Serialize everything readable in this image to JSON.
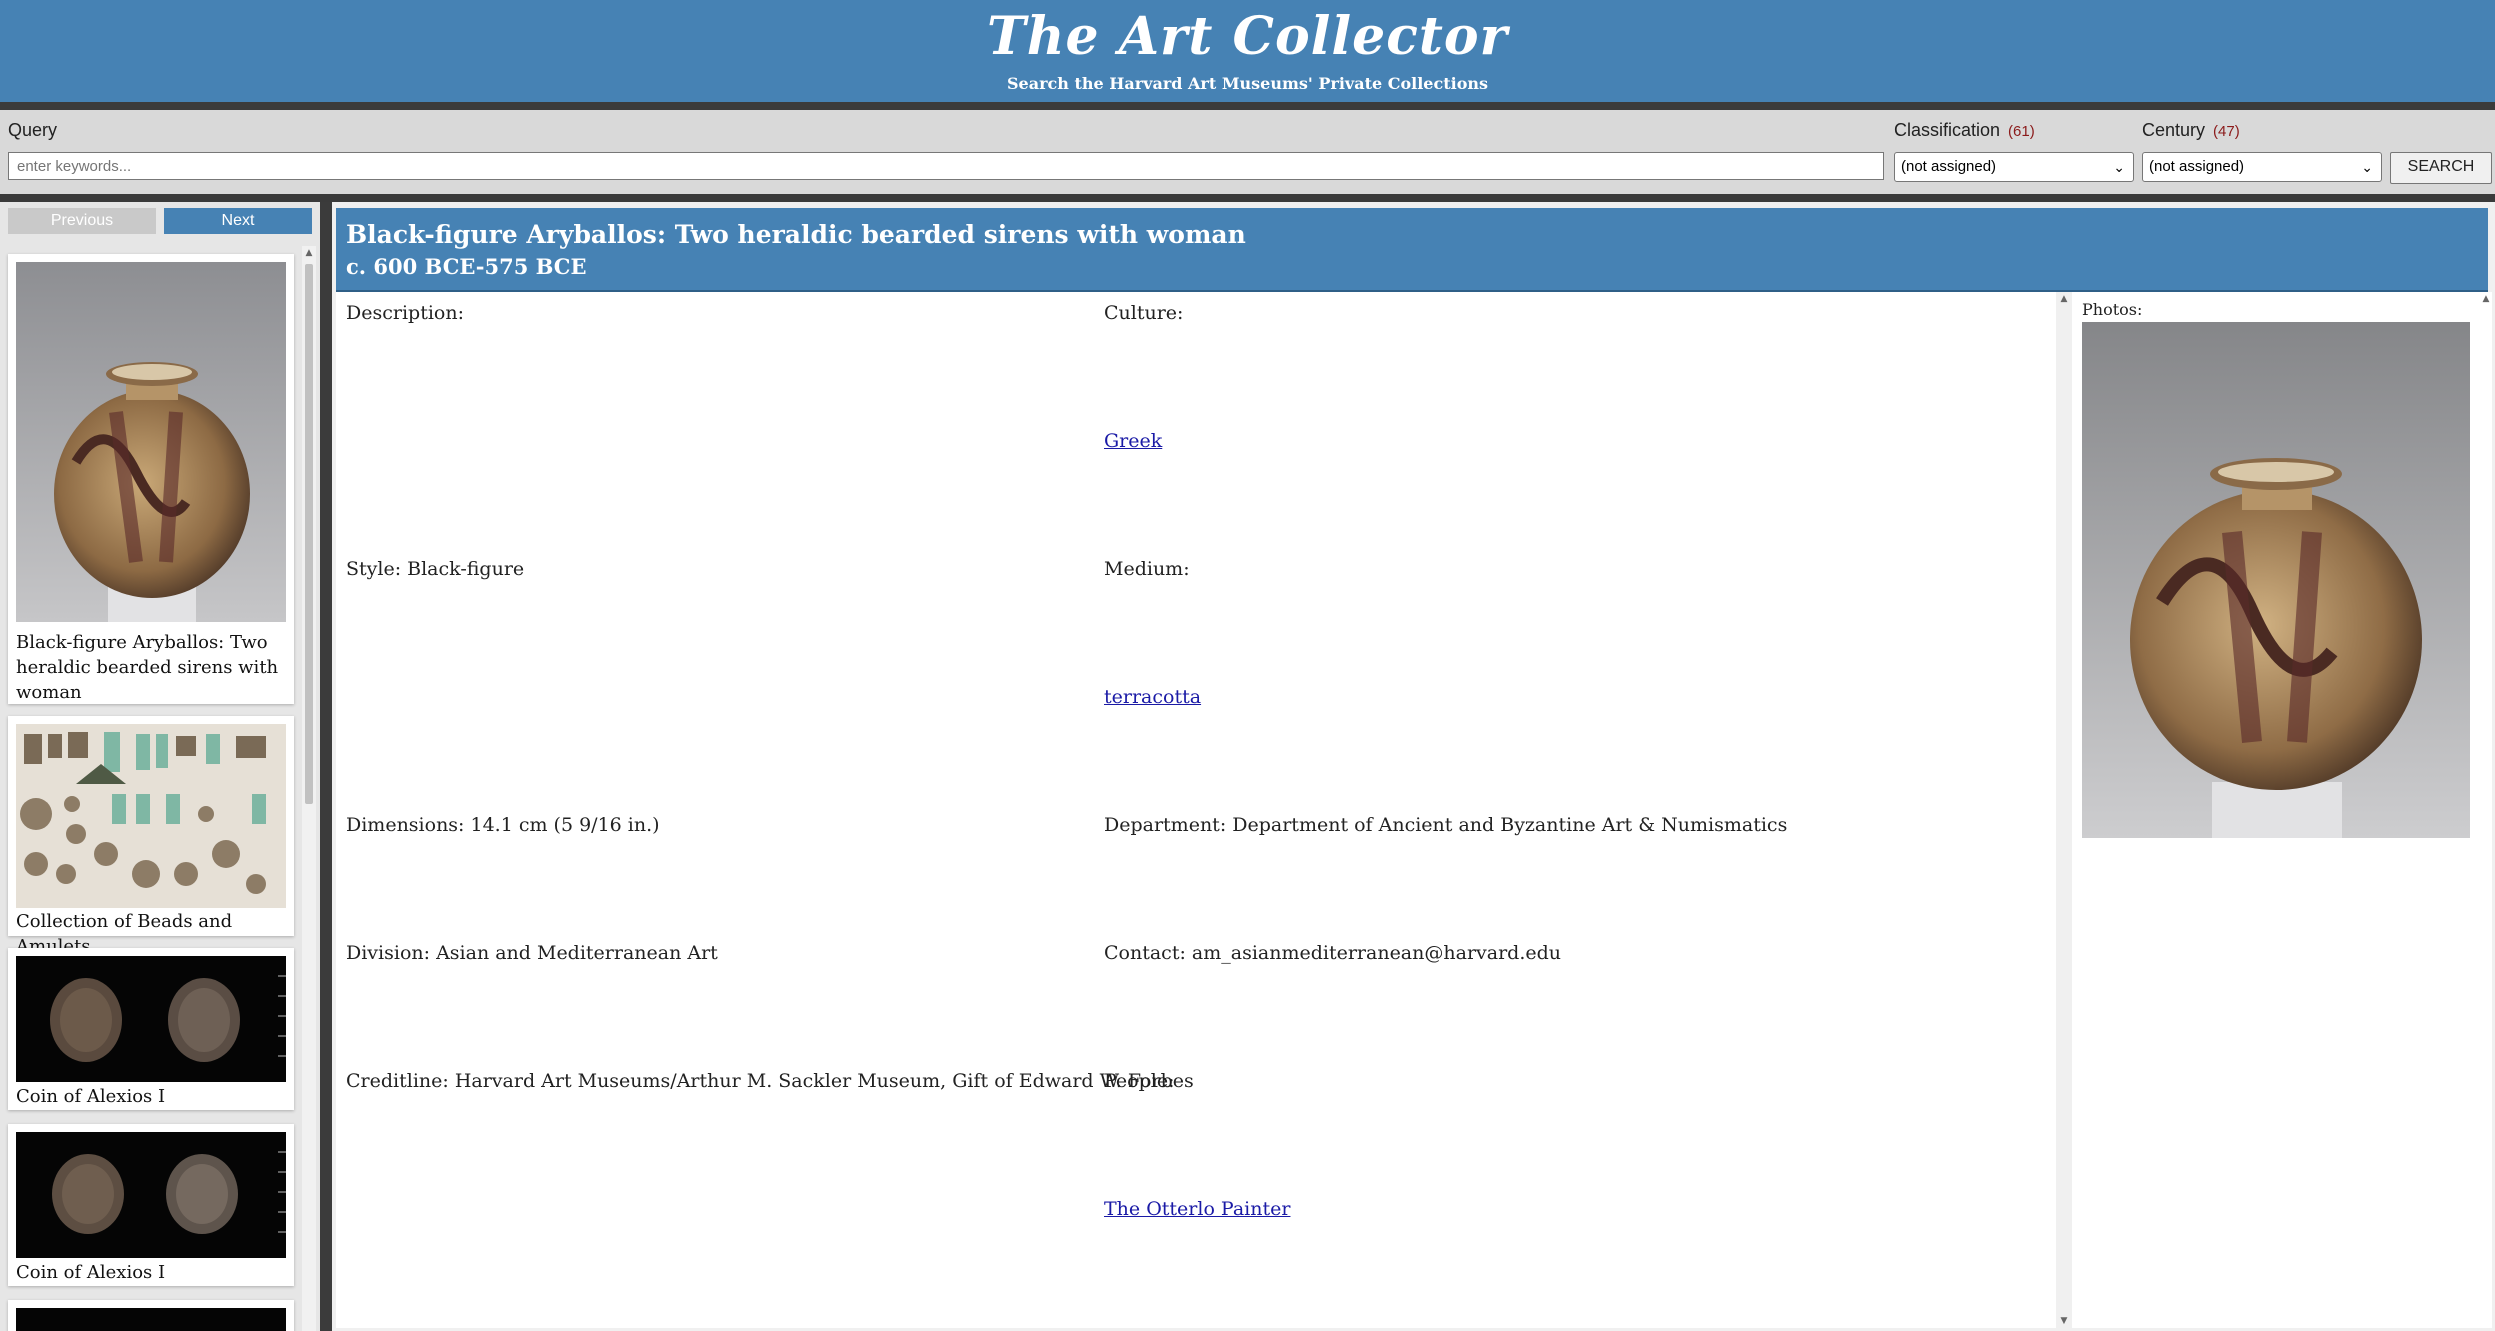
{
  "header": {
    "title": "The Art Collector",
    "subtitle": "Search the Harvard Art Museums' Private Collections"
  },
  "search": {
    "query_label": "Query",
    "query_placeholder": "enter keywords...",
    "classification_label": "Classification",
    "classification_count": "(61)",
    "classification_value": "(not assigned)",
    "century_label": "Century",
    "century_count": "(47)",
    "century_value": "(not assigned)",
    "search_button": "SEARCH"
  },
  "sidebar": {
    "previous_label": "Previous",
    "next_label": "Next",
    "items": [
      {
        "title": "Black-figure Aryballos: Two heraldic bearded sirens with woman"
      },
      {
        "title": "Collection of Beads and Amulets"
      },
      {
        "title": "Coin of Alexios I"
      },
      {
        "title": "Coin of Alexios I"
      }
    ]
  },
  "detail": {
    "title": "Black-figure Aryballos: Two heraldic bearded sirens with woman",
    "date": "c. 600 BCE-575 BCE",
    "description_label": "Description:",
    "culture_label": "Culture:",
    "culture_value": "Greek",
    "style": "Style: Black-figure",
    "medium_label": "Medium:",
    "medium_value": "terracotta",
    "dimensions": "Dimensions: 14.1 cm (5 9/16 in.)",
    "department": "Department: Department of Ancient and Byzantine Art & Numismatics",
    "division": "Division: Asian and Mediterranean Art",
    "contact": "Contact: am_asianmediterranean@harvard.edu",
    "creditline": "Creditline: Harvard Art Museums/Arthur M. Sackler Museum, Gift of Edward W. Forbes",
    "people_label": "People:",
    "people_value": "The Otterlo Painter",
    "photos_label": "Photos:"
  },
  "colors": {
    "accent": "#4682b4",
    "count": "#8b1a1a",
    "link": "#1a1aa6"
  }
}
